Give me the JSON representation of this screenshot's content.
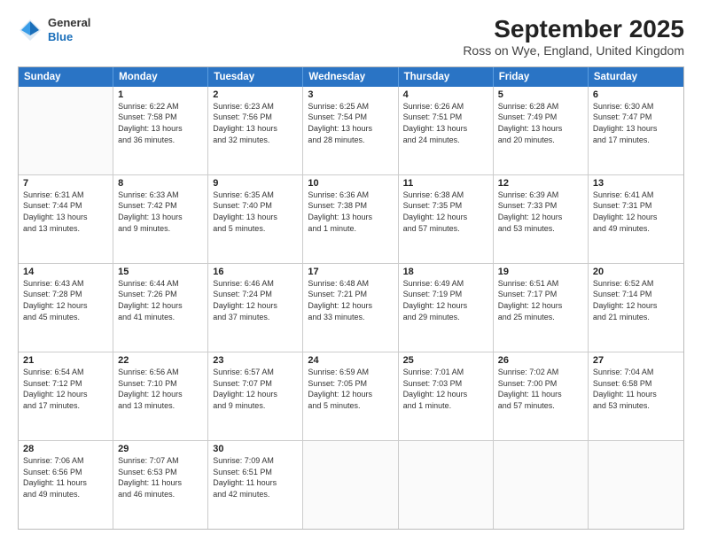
{
  "header": {
    "logo": {
      "general": "General",
      "blue": "Blue"
    },
    "title": "September 2025",
    "subtitle": "Ross on Wye, England, United Kingdom"
  },
  "calendar": {
    "days": [
      "Sunday",
      "Monday",
      "Tuesday",
      "Wednesday",
      "Thursday",
      "Friday",
      "Saturday"
    ],
    "rows": [
      [
        {
          "day": "",
          "info": ""
        },
        {
          "day": "1",
          "info": "Sunrise: 6:22 AM\nSunset: 7:58 PM\nDaylight: 13 hours\nand 36 minutes."
        },
        {
          "day": "2",
          "info": "Sunrise: 6:23 AM\nSunset: 7:56 PM\nDaylight: 13 hours\nand 32 minutes."
        },
        {
          "day": "3",
          "info": "Sunrise: 6:25 AM\nSunset: 7:54 PM\nDaylight: 13 hours\nand 28 minutes."
        },
        {
          "day": "4",
          "info": "Sunrise: 6:26 AM\nSunset: 7:51 PM\nDaylight: 13 hours\nand 24 minutes."
        },
        {
          "day": "5",
          "info": "Sunrise: 6:28 AM\nSunset: 7:49 PM\nDaylight: 13 hours\nand 20 minutes."
        },
        {
          "day": "6",
          "info": "Sunrise: 6:30 AM\nSunset: 7:47 PM\nDaylight: 13 hours\nand 17 minutes."
        }
      ],
      [
        {
          "day": "7",
          "info": "Sunrise: 6:31 AM\nSunset: 7:44 PM\nDaylight: 13 hours\nand 13 minutes."
        },
        {
          "day": "8",
          "info": "Sunrise: 6:33 AM\nSunset: 7:42 PM\nDaylight: 13 hours\nand 9 minutes."
        },
        {
          "day": "9",
          "info": "Sunrise: 6:35 AM\nSunset: 7:40 PM\nDaylight: 13 hours\nand 5 minutes."
        },
        {
          "day": "10",
          "info": "Sunrise: 6:36 AM\nSunset: 7:38 PM\nDaylight: 13 hours\nand 1 minute."
        },
        {
          "day": "11",
          "info": "Sunrise: 6:38 AM\nSunset: 7:35 PM\nDaylight: 12 hours\nand 57 minutes."
        },
        {
          "day": "12",
          "info": "Sunrise: 6:39 AM\nSunset: 7:33 PM\nDaylight: 12 hours\nand 53 minutes."
        },
        {
          "day": "13",
          "info": "Sunrise: 6:41 AM\nSunset: 7:31 PM\nDaylight: 12 hours\nand 49 minutes."
        }
      ],
      [
        {
          "day": "14",
          "info": "Sunrise: 6:43 AM\nSunset: 7:28 PM\nDaylight: 12 hours\nand 45 minutes."
        },
        {
          "day": "15",
          "info": "Sunrise: 6:44 AM\nSunset: 7:26 PM\nDaylight: 12 hours\nand 41 minutes."
        },
        {
          "day": "16",
          "info": "Sunrise: 6:46 AM\nSunset: 7:24 PM\nDaylight: 12 hours\nand 37 minutes."
        },
        {
          "day": "17",
          "info": "Sunrise: 6:48 AM\nSunset: 7:21 PM\nDaylight: 12 hours\nand 33 minutes."
        },
        {
          "day": "18",
          "info": "Sunrise: 6:49 AM\nSunset: 7:19 PM\nDaylight: 12 hours\nand 29 minutes."
        },
        {
          "day": "19",
          "info": "Sunrise: 6:51 AM\nSunset: 7:17 PM\nDaylight: 12 hours\nand 25 minutes."
        },
        {
          "day": "20",
          "info": "Sunrise: 6:52 AM\nSunset: 7:14 PM\nDaylight: 12 hours\nand 21 minutes."
        }
      ],
      [
        {
          "day": "21",
          "info": "Sunrise: 6:54 AM\nSunset: 7:12 PM\nDaylight: 12 hours\nand 17 minutes."
        },
        {
          "day": "22",
          "info": "Sunrise: 6:56 AM\nSunset: 7:10 PM\nDaylight: 12 hours\nand 13 minutes."
        },
        {
          "day": "23",
          "info": "Sunrise: 6:57 AM\nSunset: 7:07 PM\nDaylight: 12 hours\nand 9 minutes."
        },
        {
          "day": "24",
          "info": "Sunrise: 6:59 AM\nSunset: 7:05 PM\nDaylight: 12 hours\nand 5 minutes."
        },
        {
          "day": "25",
          "info": "Sunrise: 7:01 AM\nSunset: 7:03 PM\nDaylight: 12 hours\nand 1 minute."
        },
        {
          "day": "26",
          "info": "Sunrise: 7:02 AM\nSunset: 7:00 PM\nDaylight: 11 hours\nand 57 minutes."
        },
        {
          "day": "27",
          "info": "Sunrise: 7:04 AM\nSunset: 6:58 PM\nDaylight: 11 hours\nand 53 minutes."
        }
      ],
      [
        {
          "day": "28",
          "info": "Sunrise: 7:06 AM\nSunset: 6:56 PM\nDaylight: 11 hours\nand 49 minutes."
        },
        {
          "day": "29",
          "info": "Sunrise: 7:07 AM\nSunset: 6:53 PM\nDaylight: 11 hours\nand 46 minutes."
        },
        {
          "day": "30",
          "info": "Sunrise: 7:09 AM\nSunset: 6:51 PM\nDaylight: 11 hours\nand 42 minutes."
        },
        {
          "day": "",
          "info": ""
        },
        {
          "day": "",
          "info": ""
        },
        {
          "day": "",
          "info": ""
        },
        {
          "day": "",
          "info": ""
        }
      ]
    ]
  }
}
